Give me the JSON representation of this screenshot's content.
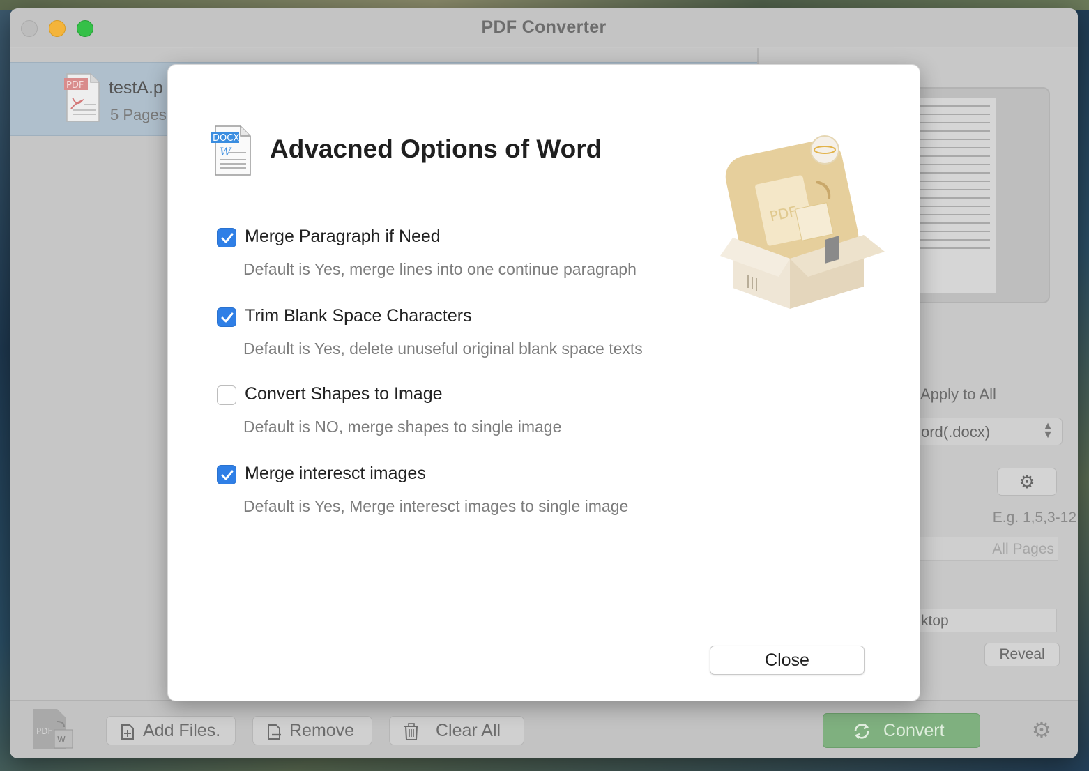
{
  "window": {
    "title": "PDF Converter"
  },
  "file_list": {
    "items": [
      {
        "name": "testA.p",
        "pages": "5 Pages",
        "icon": "pdf-file-icon",
        "badge": "PDF"
      }
    ]
  },
  "right_panel": {
    "apply_all_label": "Apply to All",
    "format_value": "ord(.docx)",
    "settings_icon": "gear-icon",
    "page_hint": "E.g. 1,5,3-12",
    "pages_placeholder": "All Pages",
    "output_path": "ktop",
    "reveal_label": "Reveal"
  },
  "toolbar": {
    "add_label": "Add Files.",
    "remove_label": "Remove",
    "clear_label": "Clear All",
    "convert_label": "Convert",
    "convert_color": "#7fb07f"
  },
  "dialog": {
    "title": "Advacned Options of Word",
    "doc_badge": "DOCX",
    "doc_letter": "W",
    "hero_label": "PDF",
    "accent_color": "#2f7fe6",
    "options": [
      {
        "label": "Merge Paragraph if Need",
        "description": "Default is Yes, merge lines into one continue paragraph",
        "checked": true
      },
      {
        "label": "Trim Blank Space Characters",
        "description": "Default is Yes, delete unuseful original blank space texts",
        "checked": true
      },
      {
        "label": "Convert Shapes to Image",
        "description": "Default is NO, merge shapes to single image",
        "checked": false
      },
      {
        "label": "Merge interesct images",
        "description": "Default is Yes, Merge interesct images to single image",
        "checked": true
      }
    ],
    "close_label": "Close"
  }
}
